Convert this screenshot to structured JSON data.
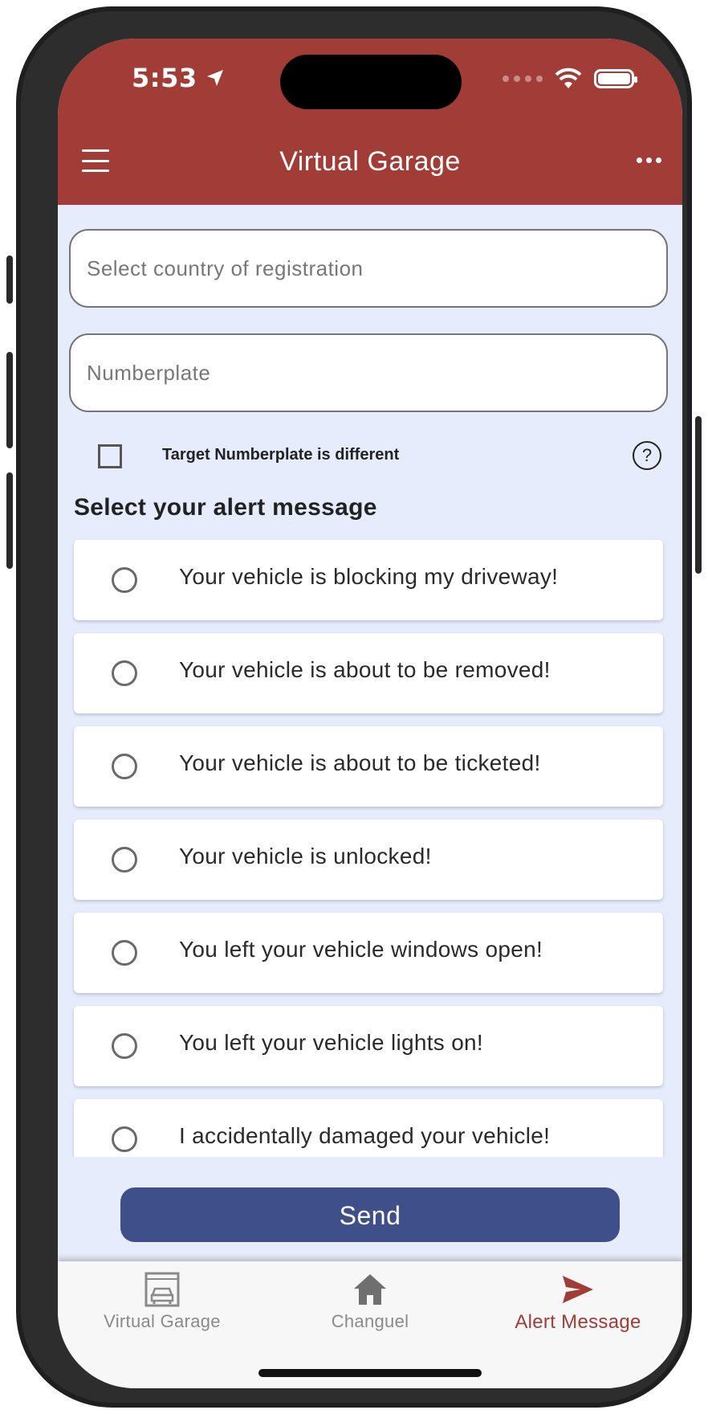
{
  "status": {
    "time": "5:53"
  },
  "header": {
    "title": "Virtual Garage"
  },
  "form": {
    "country_placeholder": "Select country of registration",
    "numberplate_placeholder": "Numberplate",
    "target_checkbox_label": "Target Numberplate is different",
    "help_symbol": "?"
  },
  "alerts": {
    "title": "Select your alert message",
    "options": [
      "Your vehicle is blocking my driveway!",
      "Your vehicle is about to be removed!",
      "Your vehicle is about to be ticketed!",
      "Your vehicle is unlocked!",
      "You left your vehicle windows open!",
      "You left your vehicle lights on!",
      "I accidentally damaged your vehicle!"
    ],
    "send_label": "Send"
  },
  "nav": {
    "items": [
      {
        "label": "Virtual Garage",
        "icon": "garage-icon"
      },
      {
        "label": "Changuel",
        "icon": "home-icon"
      },
      {
        "label": "Alert Message",
        "icon": "send-icon"
      }
    ],
    "active_index": 2
  },
  "colors": {
    "primary": "#a23c37",
    "button": "#3f4f8a",
    "background": "#e6ecfb"
  }
}
